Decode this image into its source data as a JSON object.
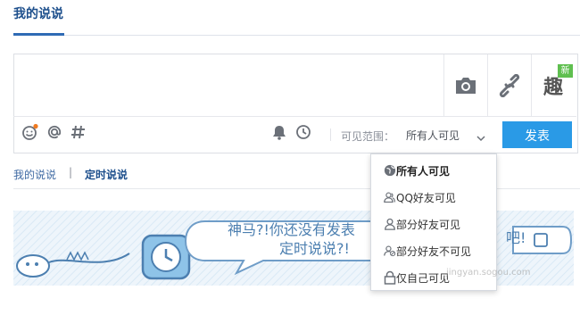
{
  "header": {
    "title": "我的说说"
  },
  "composer": {
    "range_label": "可见范围：",
    "range_value": "所有人可见",
    "post_label": "发表",
    "fun_badge": "新",
    "fun_label": "趣"
  },
  "subtabs": {
    "mine": "我的说说",
    "separator": "|",
    "scheduled": "定时说说"
  },
  "banner": {
    "text_line1": "神马?!你还没有发表",
    "text_line2": "定时说说?!",
    "text_right": "吧!"
  },
  "dropdown": {
    "items": [
      {
        "label": "所有人可见",
        "icon": "globe-icon"
      },
      {
        "label": "QQ好友可见",
        "icon": "friends-icon"
      },
      {
        "label": "部分好友可见",
        "icon": "person-icon"
      },
      {
        "label": "部分好友不可见",
        "icon": "person-block-icon"
      },
      {
        "label": "仅自己可见",
        "icon": "lock-icon"
      }
    ],
    "selected_index": 0
  },
  "watermark": {
    "text": "jingyan.sogou.com"
  },
  "colors": {
    "accent": "#2a9ae6",
    "brand": "#1d4f8c",
    "badge": "#5fbf4f"
  }
}
